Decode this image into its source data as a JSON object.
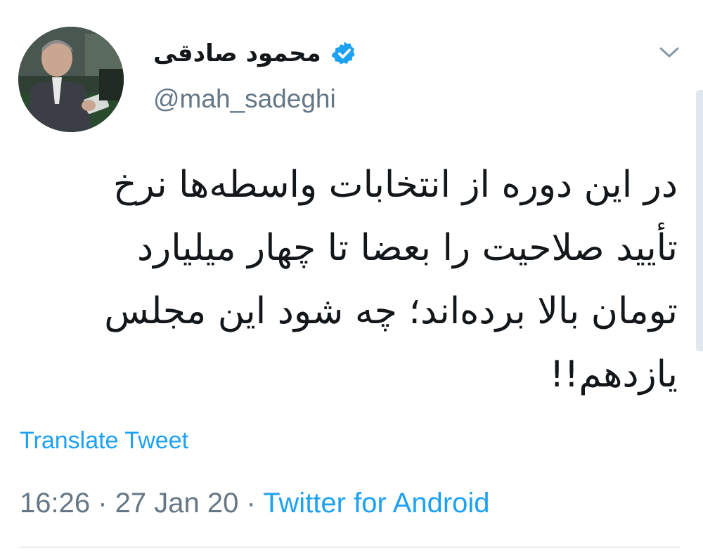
{
  "tweet": {
    "display_name": "محمود صادقی",
    "handle": "@mah_sadeghi",
    "verified_icon": "verified-badge-icon",
    "menu_icon": "chevron-down-icon",
    "text_lines": [
      "در این دوره از انتخابات واسطه‌ها نرخ",
      "تأیید صلاحیت را بعضا تا چهار میلیارد",
      "تومان بالا برده‌اند؛ چه شود این مجلس",
      "یازدهم!!"
    ],
    "translate_label": "Translate Tweet",
    "time": "16:26",
    "date": "27 Jan 20",
    "separator": " · ",
    "source": "Twitter for Android"
  },
  "colors": {
    "link": "#1da1f2",
    "text": "#14171a",
    "secondary": "#657786",
    "verified": "#1da1f2",
    "divider": "#e6ecf0"
  }
}
